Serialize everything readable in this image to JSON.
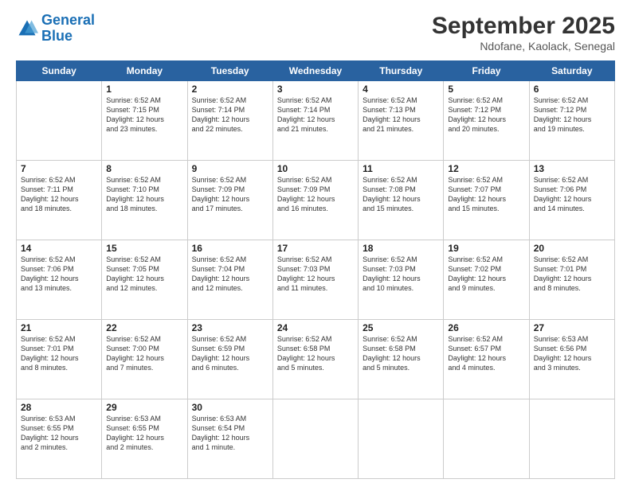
{
  "header": {
    "logo_line1": "General",
    "logo_line2": "Blue",
    "month": "September 2025",
    "location": "Ndofane, Kaolack, Senegal"
  },
  "days": [
    "Sunday",
    "Monday",
    "Tuesday",
    "Wednesday",
    "Thursday",
    "Friday",
    "Saturday"
  ],
  "weeks": [
    [
      {
        "day": "",
        "info": ""
      },
      {
        "day": "1",
        "info": "Sunrise: 6:52 AM\nSunset: 7:15 PM\nDaylight: 12 hours\nand 23 minutes."
      },
      {
        "day": "2",
        "info": "Sunrise: 6:52 AM\nSunset: 7:14 PM\nDaylight: 12 hours\nand 22 minutes."
      },
      {
        "day": "3",
        "info": "Sunrise: 6:52 AM\nSunset: 7:14 PM\nDaylight: 12 hours\nand 21 minutes."
      },
      {
        "day": "4",
        "info": "Sunrise: 6:52 AM\nSunset: 7:13 PM\nDaylight: 12 hours\nand 21 minutes."
      },
      {
        "day": "5",
        "info": "Sunrise: 6:52 AM\nSunset: 7:12 PM\nDaylight: 12 hours\nand 20 minutes."
      },
      {
        "day": "6",
        "info": "Sunrise: 6:52 AM\nSunset: 7:12 PM\nDaylight: 12 hours\nand 19 minutes."
      }
    ],
    [
      {
        "day": "7",
        "info": "Sunrise: 6:52 AM\nSunset: 7:11 PM\nDaylight: 12 hours\nand 18 minutes."
      },
      {
        "day": "8",
        "info": "Sunrise: 6:52 AM\nSunset: 7:10 PM\nDaylight: 12 hours\nand 18 minutes."
      },
      {
        "day": "9",
        "info": "Sunrise: 6:52 AM\nSunset: 7:09 PM\nDaylight: 12 hours\nand 17 minutes."
      },
      {
        "day": "10",
        "info": "Sunrise: 6:52 AM\nSunset: 7:09 PM\nDaylight: 12 hours\nand 16 minutes."
      },
      {
        "day": "11",
        "info": "Sunrise: 6:52 AM\nSunset: 7:08 PM\nDaylight: 12 hours\nand 15 minutes."
      },
      {
        "day": "12",
        "info": "Sunrise: 6:52 AM\nSunset: 7:07 PM\nDaylight: 12 hours\nand 15 minutes."
      },
      {
        "day": "13",
        "info": "Sunrise: 6:52 AM\nSunset: 7:06 PM\nDaylight: 12 hours\nand 14 minutes."
      }
    ],
    [
      {
        "day": "14",
        "info": "Sunrise: 6:52 AM\nSunset: 7:06 PM\nDaylight: 12 hours\nand 13 minutes."
      },
      {
        "day": "15",
        "info": "Sunrise: 6:52 AM\nSunset: 7:05 PM\nDaylight: 12 hours\nand 12 minutes."
      },
      {
        "day": "16",
        "info": "Sunrise: 6:52 AM\nSunset: 7:04 PM\nDaylight: 12 hours\nand 12 minutes."
      },
      {
        "day": "17",
        "info": "Sunrise: 6:52 AM\nSunset: 7:03 PM\nDaylight: 12 hours\nand 11 minutes."
      },
      {
        "day": "18",
        "info": "Sunrise: 6:52 AM\nSunset: 7:03 PM\nDaylight: 12 hours\nand 10 minutes."
      },
      {
        "day": "19",
        "info": "Sunrise: 6:52 AM\nSunset: 7:02 PM\nDaylight: 12 hours\nand 9 minutes."
      },
      {
        "day": "20",
        "info": "Sunrise: 6:52 AM\nSunset: 7:01 PM\nDaylight: 12 hours\nand 8 minutes."
      }
    ],
    [
      {
        "day": "21",
        "info": "Sunrise: 6:52 AM\nSunset: 7:01 PM\nDaylight: 12 hours\nand 8 minutes."
      },
      {
        "day": "22",
        "info": "Sunrise: 6:52 AM\nSunset: 7:00 PM\nDaylight: 12 hours\nand 7 minutes."
      },
      {
        "day": "23",
        "info": "Sunrise: 6:52 AM\nSunset: 6:59 PM\nDaylight: 12 hours\nand 6 minutes."
      },
      {
        "day": "24",
        "info": "Sunrise: 6:52 AM\nSunset: 6:58 PM\nDaylight: 12 hours\nand 5 minutes."
      },
      {
        "day": "25",
        "info": "Sunrise: 6:52 AM\nSunset: 6:58 PM\nDaylight: 12 hours\nand 5 minutes."
      },
      {
        "day": "26",
        "info": "Sunrise: 6:52 AM\nSunset: 6:57 PM\nDaylight: 12 hours\nand 4 minutes."
      },
      {
        "day": "27",
        "info": "Sunrise: 6:53 AM\nSunset: 6:56 PM\nDaylight: 12 hours\nand 3 minutes."
      }
    ],
    [
      {
        "day": "28",
        "info": "Sunrise: 6:53 AM\nSunset: 6:55 PM\nDaylight: 12 hours\nand 2 minutes."
      },
      {
        "day": "29",
        "info": "Sunrise: 6:53 AM\nSunset: 6:55 PM\nDaylight: 12 hours\nand 2 minutes."
      },
      {
        "day": "30",
        "info": "Sunrise: 6:53 AM\nSunset: 6:54 PM\nDaylight: 12 hours\nand 1 minute."
      },
      {
        "day": "",
        "info": ""
      },
      {
        "day": "",
        "info": ""
      },
      {
        "day": "",
        "info": ""
      },
      {
        "day": "",
        "info": ""
      }
    ]
  ]
}
